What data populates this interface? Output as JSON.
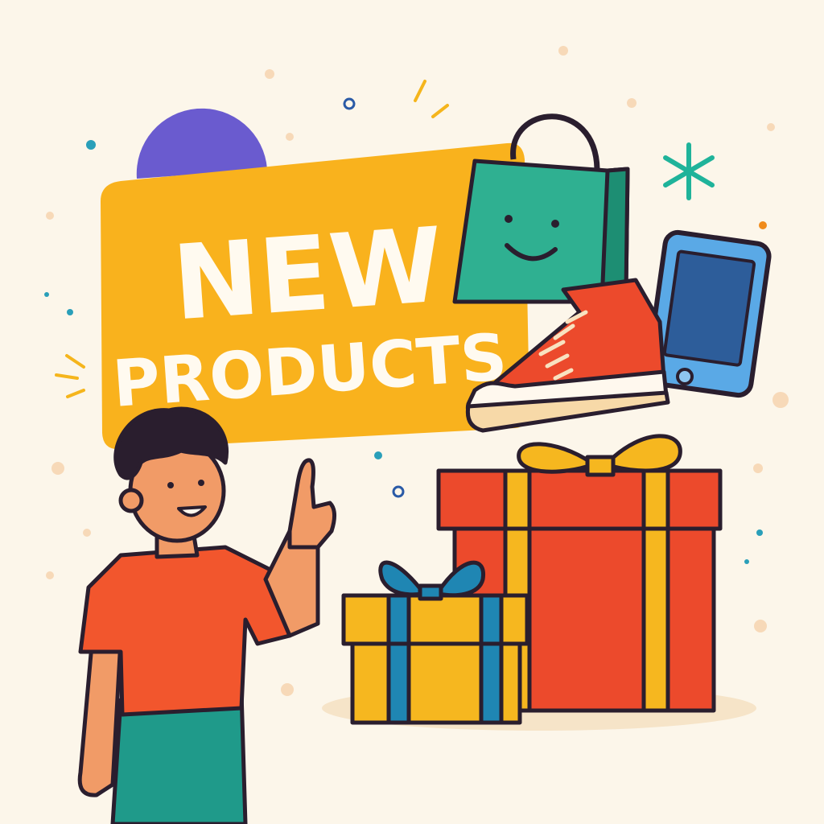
{
  "banner": {
    "line1": "NEW",
    "line2": "PRODUCTS"
  },
  "palette": {
    "background": "#fcf6ea",
    "banner": "#f9b21d",
    "shirt": "#f2562d",
    "pants": "#1f9a8a",
    "skin": "#f19b67",
    "outline": "#2a1e2e",
    "bag": "#2fb091",
    "phone": "#5aa9e6",
    "gift_red": "#ec4a2c",
    "gift_yellow": "#f6b71f",
    "ribbon_blue": "#1f86b3"
  },
  "icons": [
    "person-icon",
    "shopping-bag-icon",
    "sneaker-icon",
    "smartphone-icon",
    "gift-box-icon",
    "sparkle-icon"
  ]
}
